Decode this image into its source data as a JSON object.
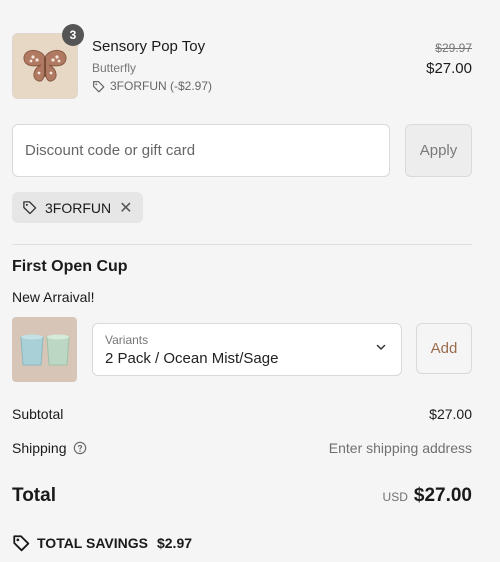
{
  "line_item": {
    "quantity": "3",
    "title": "Sensory Pop Toy",
    "variant": "Butterfly",
    "discount": "3FORFUN (-$2.97)",
    "original_price": "$29.97",
    "price": "$27.00"
  },
  "discount": {
    "placeholder": "Discount code or gift card",
    "apply_label": "Apply",
    "applied_code": "3FORFUN"
  },
  "upsell": {
    "title": "First Open Cup",
    "subtitle": "New Arraival!",
    "variant_label": "Variants",
    "variant_value": "2 Pack / Ocean Mist/Sage",
    "add_label": "Add"
  },
  "summary": {
    "subtotal_label": "Subtotal",
    "subtotal_value": "$27.00",
    "shipping_label": "Shipping",
    "shipping_value": "Enter shipping address",
    "total_label": "Total",
    "currency": "USD",
    "total_value": "$27.00",
    "savings_label": "TOTAL SAVINGS",
    "savings_value": "$2.97"
  },
  "colors": {
    "background": "#f5f5f5",
    "accent_brown": "#9c6b4e",
    "muted_text": "#707070"
  },
  "icons": [
    "butterfly-image",
    "tag-icon",
    "close-icon",
    "chevron-down-icon",
    "help-icon",
    "cup-image"
  ]
}
